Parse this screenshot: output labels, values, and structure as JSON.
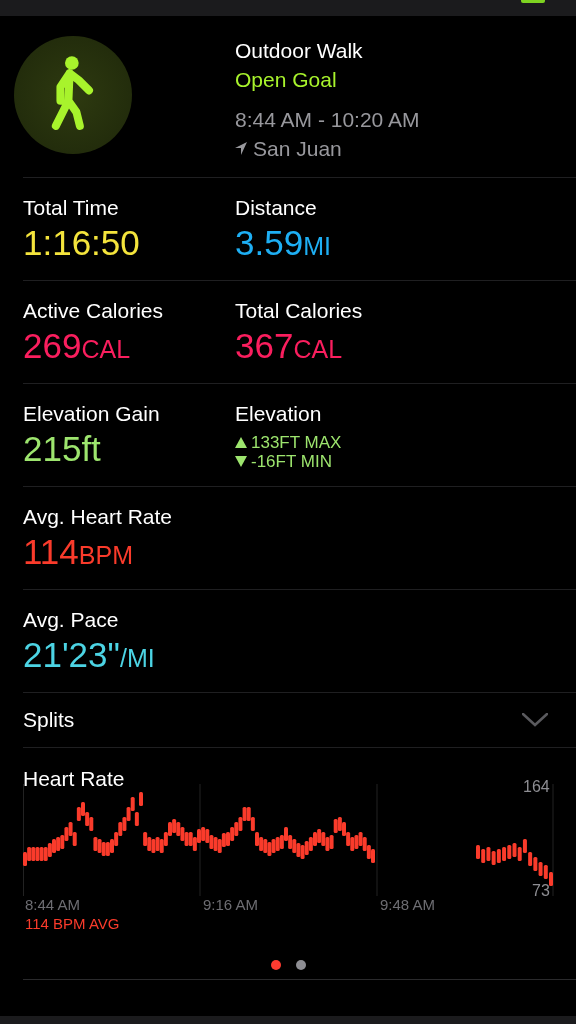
{
  "header": {
    "title": "Outdoor Walk",
    "goal": "Open Goal",
    "time_range": "8:44 AM - 10:20 AM",
    "location": "San Juan"
  },
  "metric_rows": [
    {
      "cells": [
        {
          "kind": "value",
          "label": "Total Time",
          "value": "1:16:50",
          "color": "#f4e43c"
        },
        {
          "kind": "value",
          "label": "Distance",
          "value": "3.59",
          "unit": "MI",
          "color": "#1eaff4"
        }
      ]
    },
    {
      "cells": [
        {
          "kind": "value",
          "label": "Active Calories",
          "value": "269",
          "unit": "CAL",
          "color": "#fa1e5e"
        },
        {
          "kind": "value",
          "label": "Total Calories",
          "value": "367",
          "unit": "CAL",
          "color": "#fa1e5e"
        }
      ]
    },
    {
      "cells": [
        {
          "kind": "value",
          "label": "Elevation Gain",
          "value": "215ft",
          "color": "#9de56e"
        },
        {
          "kind": "range",
          "label": "Elevation",
          "max": "133FT MAX",
          "min": "-16FT MIN",
          "color": "#9de56e"
        }
      ]
    },
    {
      "cells": [
        {
          "kind": "value",
          "label": "Avg. Heart Rate",
          "value": "114",
          "unit": "BPM",
          "color": "#fa3b2b"
        }
      ]
    },
    {
      "cells": [
        {
          "kind": "value",
          "label": "Avg. Pace",
          "value": "21'23\"",
          "unit": "/MI",
          "color": "#4cd4e4"
        }
      ]
    }
  ],
  "splits": {
    "label": "Splits",
    "expanded": false
  },
  "heart_rate": {
    "title": "Heart Rate",
    "y_max": "164",
    "y_min": "73",
    "x_labels": [
      "8:44 AM",
      "9:16 AM",
      "9:48 AM"
    ],
    "average": "114 BPM AVG"
  },
  "page_dots": [
    {
      "selected": true
    },
    {
      "selected": false
    }
  ]
}
